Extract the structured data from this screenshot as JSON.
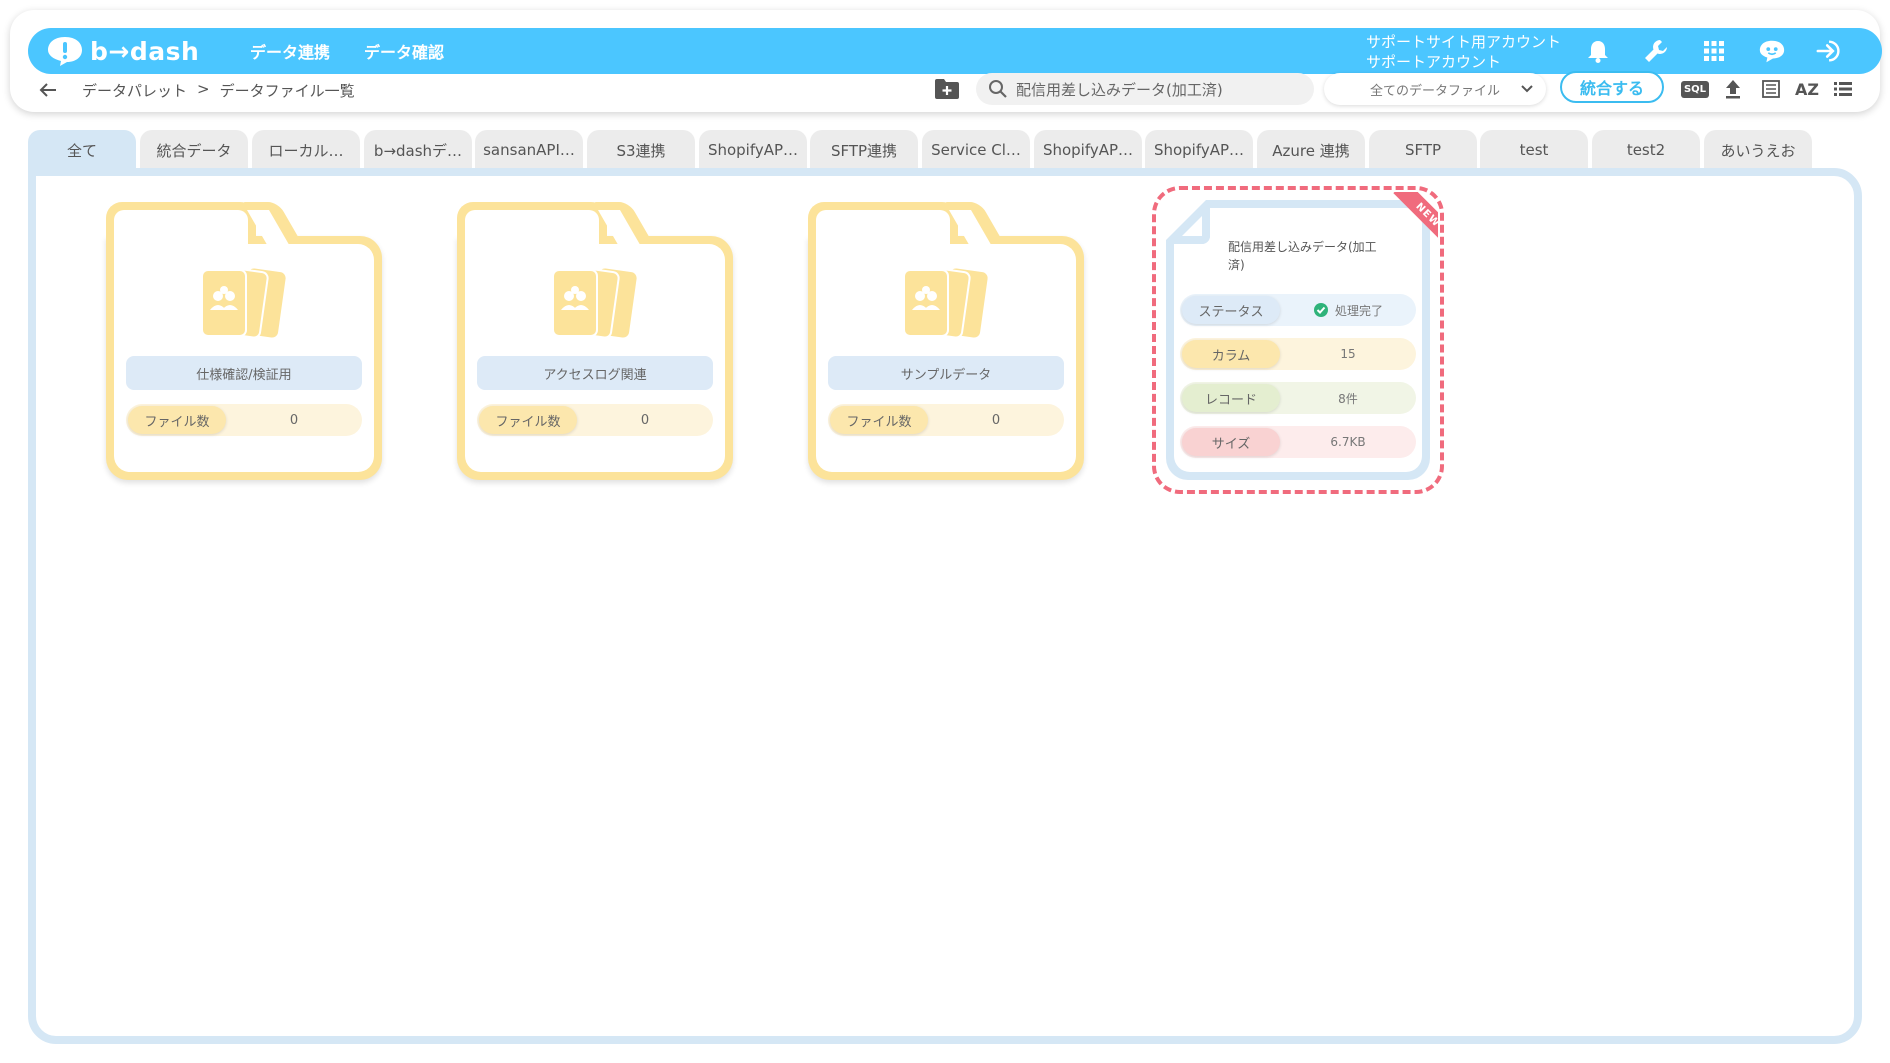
{
  "app": {
    "logo_text": "b→dash",
    "nav": [
      "データ連携",
      "データ確認"
    ],
    "account_line1": "サポートサイト用アカウント",
    "account_line2": "サポートアカウント",
    "brand_color": "#4bc6ff"
  },
  "toolbar": {
    "breadcrumb": [
      "データパレット",
      ">",
      "データファイル一覧"
    ],
    "search_value": "配信用差し込みデータ(加工済)",
    "filter_selected": "全てのデータファイル",
    "merge_label": "統合する",
    "sql_label": "SQL",
    "az_label": "AZ"
  },
  "tabs": [
    "全て",
    "統合データ",
    "ローカル…",
    "b→dashデ…",
    "sansanAPI…",
    "S3連携",
    "ShopifyAP…",
    "SFTP連携",
    "Service Cl…",
    "ShopifyAP…",
    "ShopifyAP…",
    "Azure 連携",
    "SFTP",
    "test",
    "test2",
    "あいうえお"
  ],
  "folders": [
    {
      "name": "仕様確認/検証用",
      "count_label": "ファイル数",
      "count": "0"
    },
    {
      "name": "アクセスログ関連",
      "count_label": "ファイル数",
      "count": "0"
    },
    {
      "name": "サンプルデータ",
      "count_label": "ファイル数",
      "count": "0"
    }
  ],
  "file": {
    "badge": "NEW",
    "title": "配信用差し込みデータ(加工済)",
    "rows": {
      "status_label": "ステータス",
      "status_value": "処理完了",
      "column_label": "カラム",
      "column_value": "15",
      "record_label": "レコード",
      "record_value": "8件",
      "size_label": "サイズ",
      "size_value": "6.7KB"
    }
  }
}
